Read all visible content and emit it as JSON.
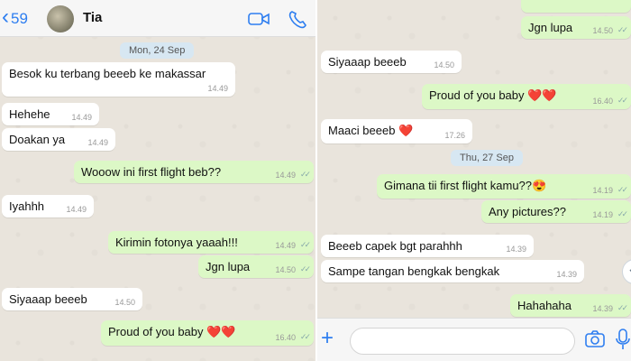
{
  "left_panel": {
    "header": {
      "back_count": "59",
      "contact_name": "Tia",
      "icons": [
        "video-call-icon",
        "voice-call-icon"
      ]
    },
    "date_badge": "Mon, 24 Sep",
    "messages": [
      {
        "text": "Besok ku terbang beeeb ke makassar",
        "time": "14.49",
        "dir": "in"
      },
      {
        "text": "Hehehe",
        "time": "14.49",
        "dir": "in"
      },
      {
        "text": "Doakan ya",
        "time": "14.49",
        "dir": "in"
      },
      {
        "text": "Wooow ini first flight beb??",
        "time": "14.49",
        "dir": "out"
      },
      {
        "text": "Iyahhh",
        "time": "14.49",
        "dir": "in"
      },
      {
        "text": "Kirimin fotonya yaaah!!!",
        "time": "14.49",
        "dir": "out"
      },
      {
        "text": "Jgn lupa",
        "time": "14.50",
        "dir": "out"
      },
      {
        "text": "Siyaaap beeeb",
        "time": "14.50",
        "dir": "in"
      },
      {
        "text": "Proud of you baby",
        "emoji": "❤️❤️",
        "time": "16.40",
        "dir": "out"
      }
    ]
  },
  "right_panel": {
    "date_badge": "Thu, 27 Sep",
    "messages": [
      {
        "text": "Jgn lupa",
        "time": "14.50",
        "dir": "out"
      },
      {
        "text": "Siyaaap beeeb",
        "time": "14.50",
        "dir": "in"
      },
      {
        "text": "Proud of you baby",
        "emoji": "❤️❤️",
        "time": "16.40",
        "dir": "out"
      },
      {
        "text": "Maaci beeeb",
        "emoji": "❤️",
        "time": "17.26",
        "dir": "in"
      },
      {
        "text": "Gimana tii first flight kamu??",
        "emoji": "😍",
        "time": "14.19",
        "dir": "out"
      },
      {
        "text": "Any pictures??",
        "time": "14.19",
        "dir": "out"
      },
      {
        "text": "Beeeb capek bgt parahhh",
        "time": "14.39",
        "dir": "in"
      },
      {
        "text": "Sampe tangan bengkak bengkak",
        "time": "14.39",
        "dir": "in"
      },
      {
        "text": "Hahahaha",
        "time": "14.39",
        "dir": "out"
      }
    ],
    "input_bar": {
      "icons": [
        "add-icon",
        "camera-icon",
        "microphone-icon"
      ]
    },
    "scroll_button_icon": "chevron-down-icon"
  },
  "colors": {
    "incoming": "#ffffff",
    "outgoing": "#dcf8c6",
    "accent": "#2e7ef0",
    "background": "#e9e4dc"
  }
}
